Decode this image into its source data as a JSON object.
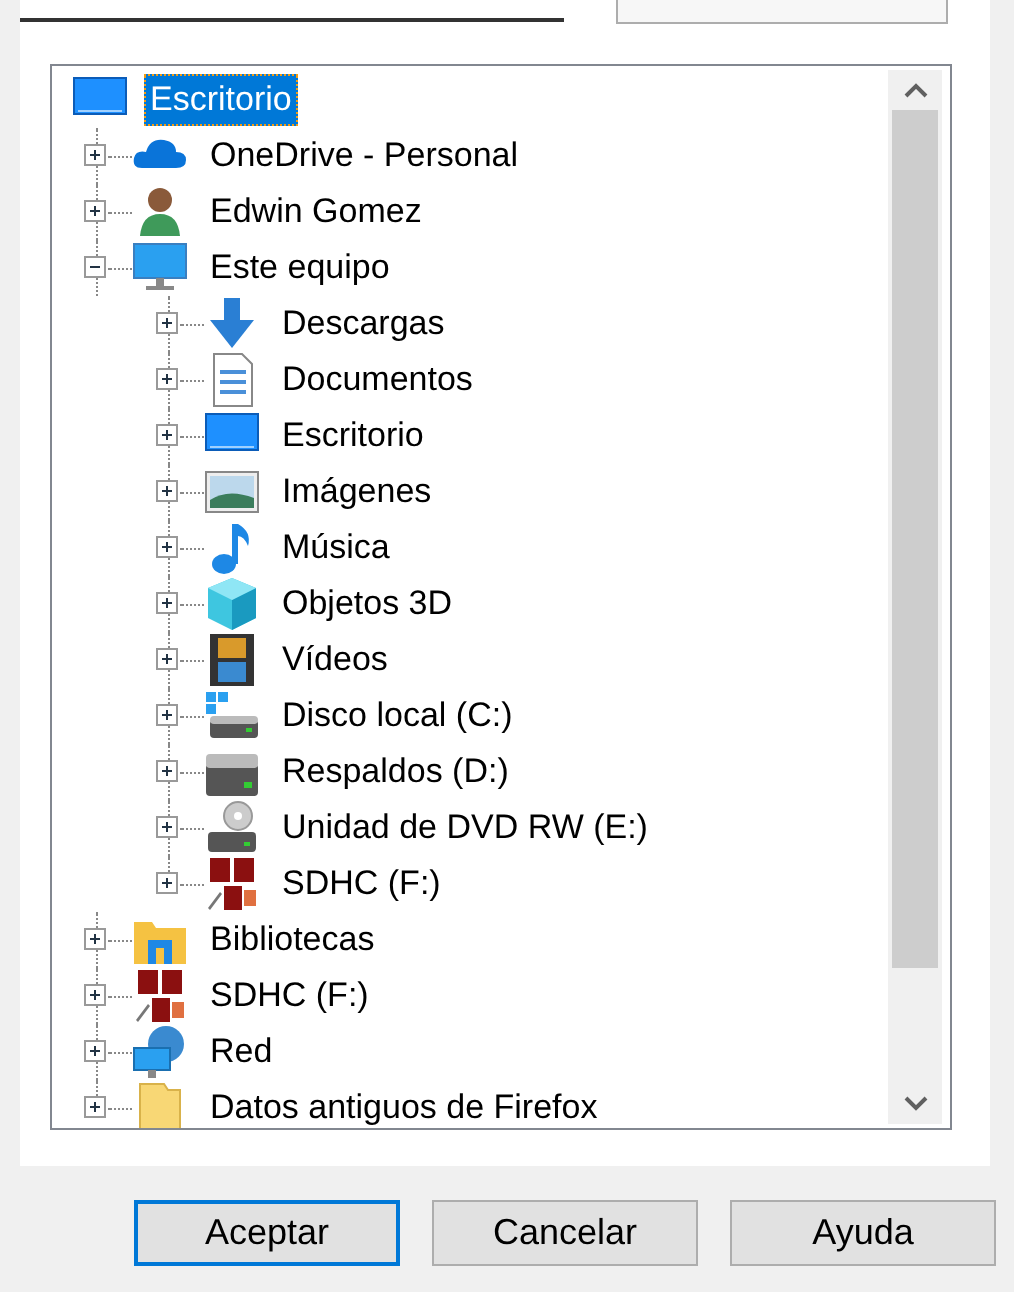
{
  "tree": {
    "items": [
      {
        "label": "Escritorio",
        "kind": "desktop",
        "selected": true,
        "children": [
          {
            "label": "OneDrive - Personal",
            "kind": "cloud",
            "selected": false,
            "expanded": false
          },
          {
            "label": "Edwin Gomez",
            "kind": "user",
            "selected": false,
            "expanded": false
          },
          {
            "label": "Este equipo",
            "kind": "computer",
            "selected": false,
            "expanded": true,
            "children": [
              {
                "label": "Descargas",
                "kind": "download",
                "selected": false,
                "expanded": false
              },
              {
                "label": "Documentos",
                "kind": "document",
                "selected": false,
                "expanded": false
              },
              {
                "label": "Escritorio",
                "kind": "desktop",
                "selected": false,
                "expanded": false
              },
              {
                "label": "Imágenes",
                "kind": "pictures",
                "selected": false,
                "expanded": false
              },
              {
                "label": "Música",
                "kind": "music",
                "selected": false,
                "expanded": false
              },
              {
                "label": "Objetos 3D",
                "kind": "cube",
                "selected": false,
                "expanded": false
              },
              {
                "label": "Vídeos",
                "kind": "film",
                "selected": false,
                "expanded": false
              },
              {
                "label": "Disco local (C:)",
                "kind": "system-drive",
                "selected": false,
                "expanded": false
              },
              {
                "label": "Respaldos (D:)",
                "kind": "drive",
                "selected": false,
                "expanded": false
              },
              {
                "label": "Unidad de DVD RW (E:)",
                "kind": "dvd",
                "selected": false,
                "expanded": false
              },
              {
                "label": "SDHC (F:)",
                "kind": "sd",
                "selected": false,
                "expanded": false
              }
            ]
          },
          {
            "label": "Bibliotecas",
            "kind": "library",
            "selected": false,
            "expanded": false
          },
          {
            "label": "SDHC (F:)",
            "kind": "sd",
            "selected": false,
            "expanded": false
          },
          {
            "label": "Red",
            "kind": "network",
            "selected": false,
            "expanded": false
          },
          {
            "label": "Datos antiguos de Firefox",
            "kind": "folder",
            "selected": false,
            "expanded": false
          }
        ]
      }
    ]
  },
  "buttons": [
    {
      "label": "Aceptar",
      "default": true
    },
    {
      "label": "Cancelar",
      "default": false
    },
    {
      "label": "Ayuda",
      "default": false
    }
  ]
}
